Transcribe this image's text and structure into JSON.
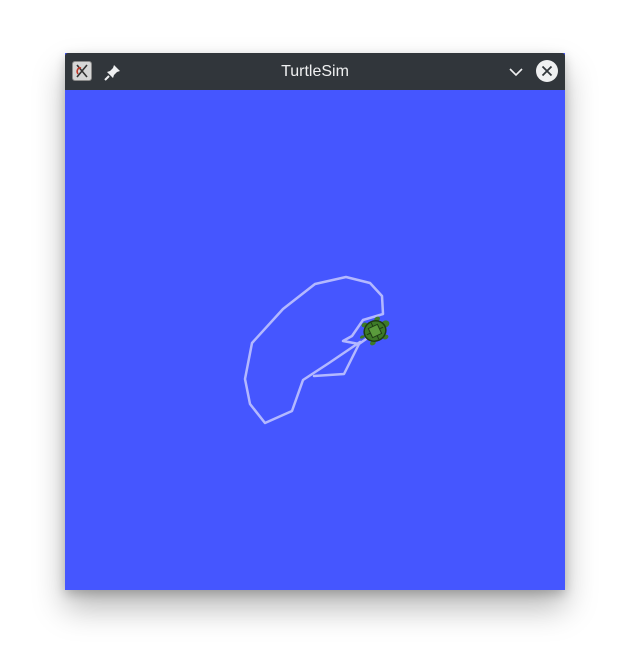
{
  "window": {
    "title": "TurtleSim",
    "icons": {
      "app": "turtlesim-app-icon",
      "pin": "pin-icon",
      "minimize": "chevron-down-icon",
      "close": "close-icon"
    }
  },
  "canvas": {
    "background_color": "#4556ff",
    "pen_color": "#b3b8ff",
    "turtle_color": "#3d7a28"
  }
}
